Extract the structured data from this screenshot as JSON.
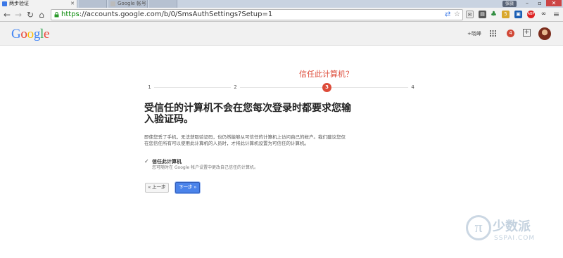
{
  "browser": {
    "tabs": [
      {
        "title": "两步验证",
        "active": true
      },
      {
        "title": "",
        "active": false
      },
      {
        "title": "Google 帐号",
        "active": false
      },
      {
        "title": "",
        "active": false
      }
    ],
    "user_badge": "张骁",
    "url_scheme": "https",
    "url_rest": "://accounts.google.com/b/0/SmsAuthSettings?Setup=1",
    "extension_badges": {
      "gmail_count": "5",
      "abp": "ABP"
    }
  },
  "header": {
    "logo_letters": [
      "G",
      "o",
      "o",
      "g",
      "l",
      "e"
    ],
    "logo_colors": [
      "#4285f4",
      "#ea4335",
      "#fbbc05",
      "#4285f4",
      "#34a853",
      "#ea4335"
    ],
    "plus_user": "+晓峰",
    "notification_count": "4"
  },
  "wizard": {
    "step_title": "信任此计算机？",
    "steps": [
      "1",
      "2",
      "3",
      "4"
    ],
    "current_step": 3,
    "heading": "受信任的计算机不会在您每次登录时都要求您输入验证码。",
    "description": "即使您丢了手机，无法获取验证码，也仍然能够从可信任的计算机上访问自己的帐户。我们建议您仅在您信任所有可以使用此计算机的人员时，才将此计算机设置为可信任的计算机。",
    "checkbox_label": "信任此计算机",
    "checkbox_checked": true,
    "checkbox_hint": "您可随时在 Google 帐户设置中更改自己信任的计算机。",
    "back_label": "« 上一步",
    "next_label": "下一步 »"
  },
  "watermark": {
    "logo": "π",
    "text": "少数派",
    "sub": "SSPAI.COM"
  },
  "colors": {
    "accent_red": "#dd4b39",
    "primary_blue": "#4a83ea",
    "url_green": "#0a8a0a"
  }
}
